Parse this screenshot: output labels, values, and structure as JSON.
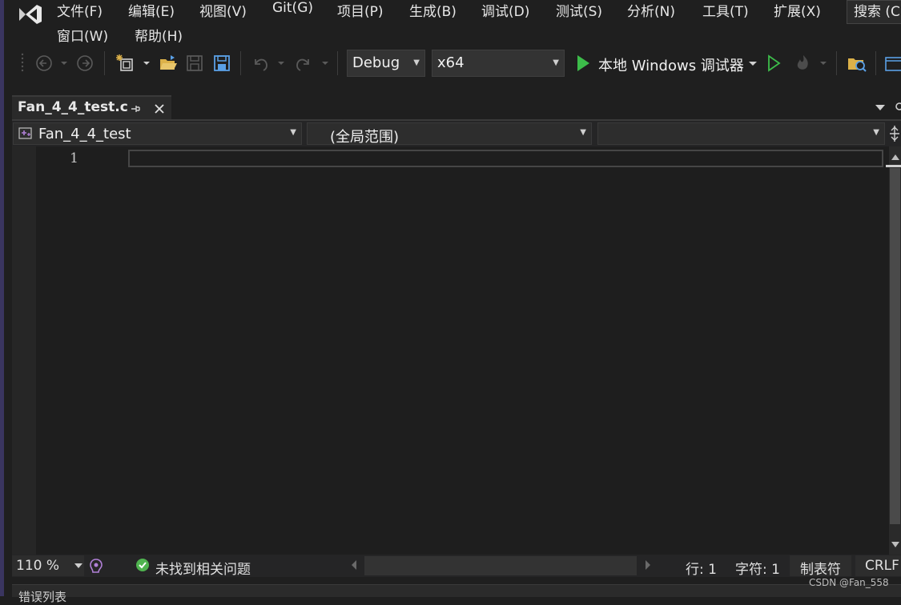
{
  "menu": {
    "items": [
      "文件(F)",
      "编辑(E)",
      "视图(V)",
      "Git(G)",
      "项目(P)",
      "生成(B)",
      "调试(D)",
      "测试(S)",
      "分析(N)",
      "工具(T)",
      "扩展(X)"
    ],
    "row2": [
      "窗口(W)",
      "帮助(H)"
    ],
    "search": "搜索 (C"
  },
  "toolbar": {
    "configuration": "Debug",
    "platform": "x64",
    "run_label": "本地 Windows 调试器"
  },
  "tab": {
    "filename": "Fan_4_4_test.c",
    "pin_icon": "pin-icon",
    "close_icon": "close-icon"
  },
  "navbar": {
    "project": "Fan_4_4_test",
    "scope": "(全局范围)",
    "member": ""
  },
  "editor": {
    "line_numbers": [
      "1"
    ],
    "content": ""
  },
  "statusbar": {
    "zoom": "110 %",
    "issues": "未找到相关问题",
    "line": "行: 1",
    "char": "字符: 1",
    "indent": "制表符",
    "eol": "CRLF"
  },
  "bottom_panel": {
    "label": "错误列表"
  },
  "watermark": "CSDN @Fan_558",
  "colors": {
    "play_green": "#3cbc4a",
    "check_green": "#4fb34f",
    "folder_yellow": "#dcb149",
    "save_blue": "#5aa0e6"
  }
}
